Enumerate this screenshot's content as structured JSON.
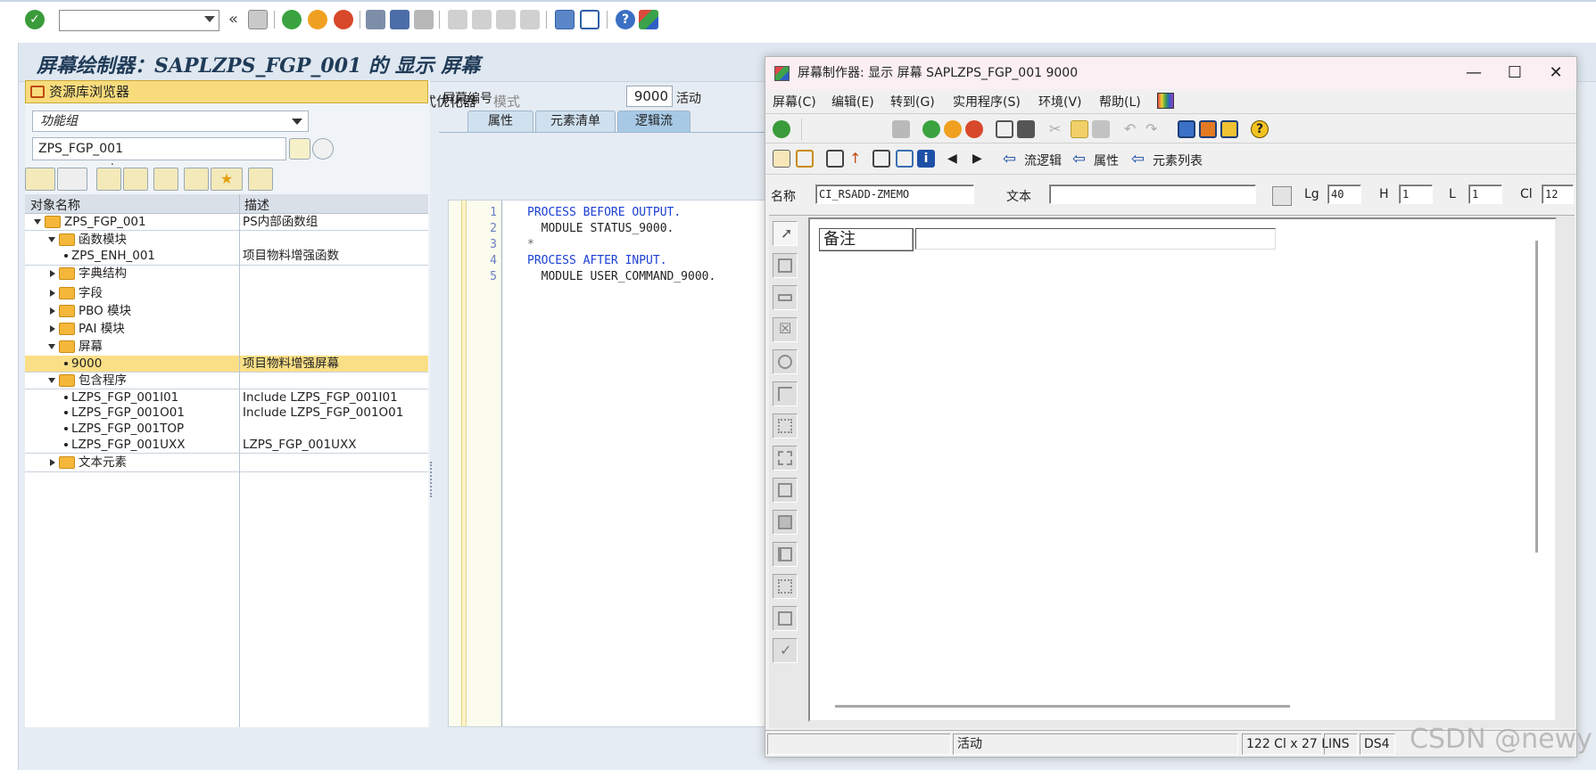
{
  "toolbar": {
    "command_value": "",
    "icons": [
      "check-icon",
      "save-icon",
      "back-icon",
      "exit-icon",
      "cancel-icon",
      "print-icon",
      "find-icon",
      "find-next-icon",
      "first-page-icon",
      "prev-page-icon",
      "next-page-icon",
      "last-page-icon",
      "new-session-icon",
      "shortcut-icon",
      "help-icon",
      "customize-icon"
    ]
  },
  "main": {
    "title": "屏幕绘制器：SAPLZPS_FGP_001 的 显示 屏幕",
    "tools": {
      "layout_label": "布局",
      "pretty_printer_label": "格式优化器",
      "pattern_label": "模式"
    }
  },
  "repo": {
    "header": "资源库浏览器",
    "object_type": "功能组",
    "object_name": "ZPS_FGP_001",
    "dot": ".",
    "col_name": "对象名称",
    "col_desc": "描述",
    "rows": [
      {
        "name": "ZPS_FGP_001",
        "desc": "PS内部函数组"
      },
      {
        "name": "函数模块",
        "desc": ""
      },
      {
        "name": "ZPS_ENH_001",
        "desc": "项目物料增强函数"
      },
      {
        "name": "字典结构",
        "desc": ""
      },
      {
        "name": "字段",
        "desc": ""
      },
      {
        "name": "PBO 模块",
        "desc": ""
      },
      {
        "name": "PAI 模块",
        "desc": ""
      },
      {
        "name": "屏幕",
        "desc": ""
      },
      {
        "name": "9000",
        "desc": "项目物料增强屏幕"
      },
      {
        "name": "包含程序",
        "desc": ""
      },
      {
        "name": "LZPS_FGP_001I01",
        "desc": "Include LZPS_FGP_001I01"
      },
      {
        "name": "LZPS_FGP_001O01",
        "desc": "Include LZPS_FGP_001O01"
      },
      {
        "name": "LZPS_FGP_001TOP",
        "desc": ""
      },
      {
        "name": "LZPS_FGP_001UXX",
        "desc": "LZPS_FGP_001UXX"
      },
      {
        "name": "文本元素",
        "desc": ""
      }
    ]
  },
  "flow": {
    "screen_no_label": "屏幕编号",
    "screen_no": "9000",
    "status": "活动",
    "tabs": [
      "属性",
      "元素清单",
      "逻辑流"
    ],
    "line_numbers": [
      "1",
      "2",
      "3",
      "4",
      "5"
    ],
    "code": [
      "PROCESS BEFORE OUTPUT.",
      "  MODULE STATUS_9000.",
      "*",
      "PROCESS AFTER INPUT.",
      "  MODULE USER_COMMAND_9000."
    ]
  },
  "painter": {
    "title": "屏幕制作器:  显示 屏幕 SAPLZPS_FGP_001 9000",
    "minimize": "—",
    "maximize": "☐",
    "close": "✕",
    "menu": [
      "屏幕(C)",
      "编辑(E)",
      "转到(G)",
      "实用程序(S)",
      "环境(V)",
      "帮助(L)"
    ],
    "nav": {
      "flow_logic": "流逻辑",
      "attributes": "属性",
      "element_list": "元素列表"
    },
    "fields": {
      "name_label": "名称",
      "name_value": "CI_RSADD-ZMEMO",
      "text_label": "文本",
      "text_value": "",
      "lg_label": "Lg",
      "lg_value": "40",
      "h_label": "H",
      "h_value": "1",
      "l_label": "L",
      "l_value": "1",
      "cl_label": "Cl",
      "cl_value": "12"
    },
    "canvas": {
      "note_label": "备注",
      "note_value": ""
    },
    "status": {
      "state": "活动",
      "size": "122 Cl x 27 L",
      "mode": "INS",
      "system": "DS4"
    }
  },
  "watermark": "CSDN @newy",
  "colors": {
    "highlight": "#fbdf86",
    "header_yellow": "#f8dc7c",
    "keyword_blue": "#1b3fd6"
  }
}
